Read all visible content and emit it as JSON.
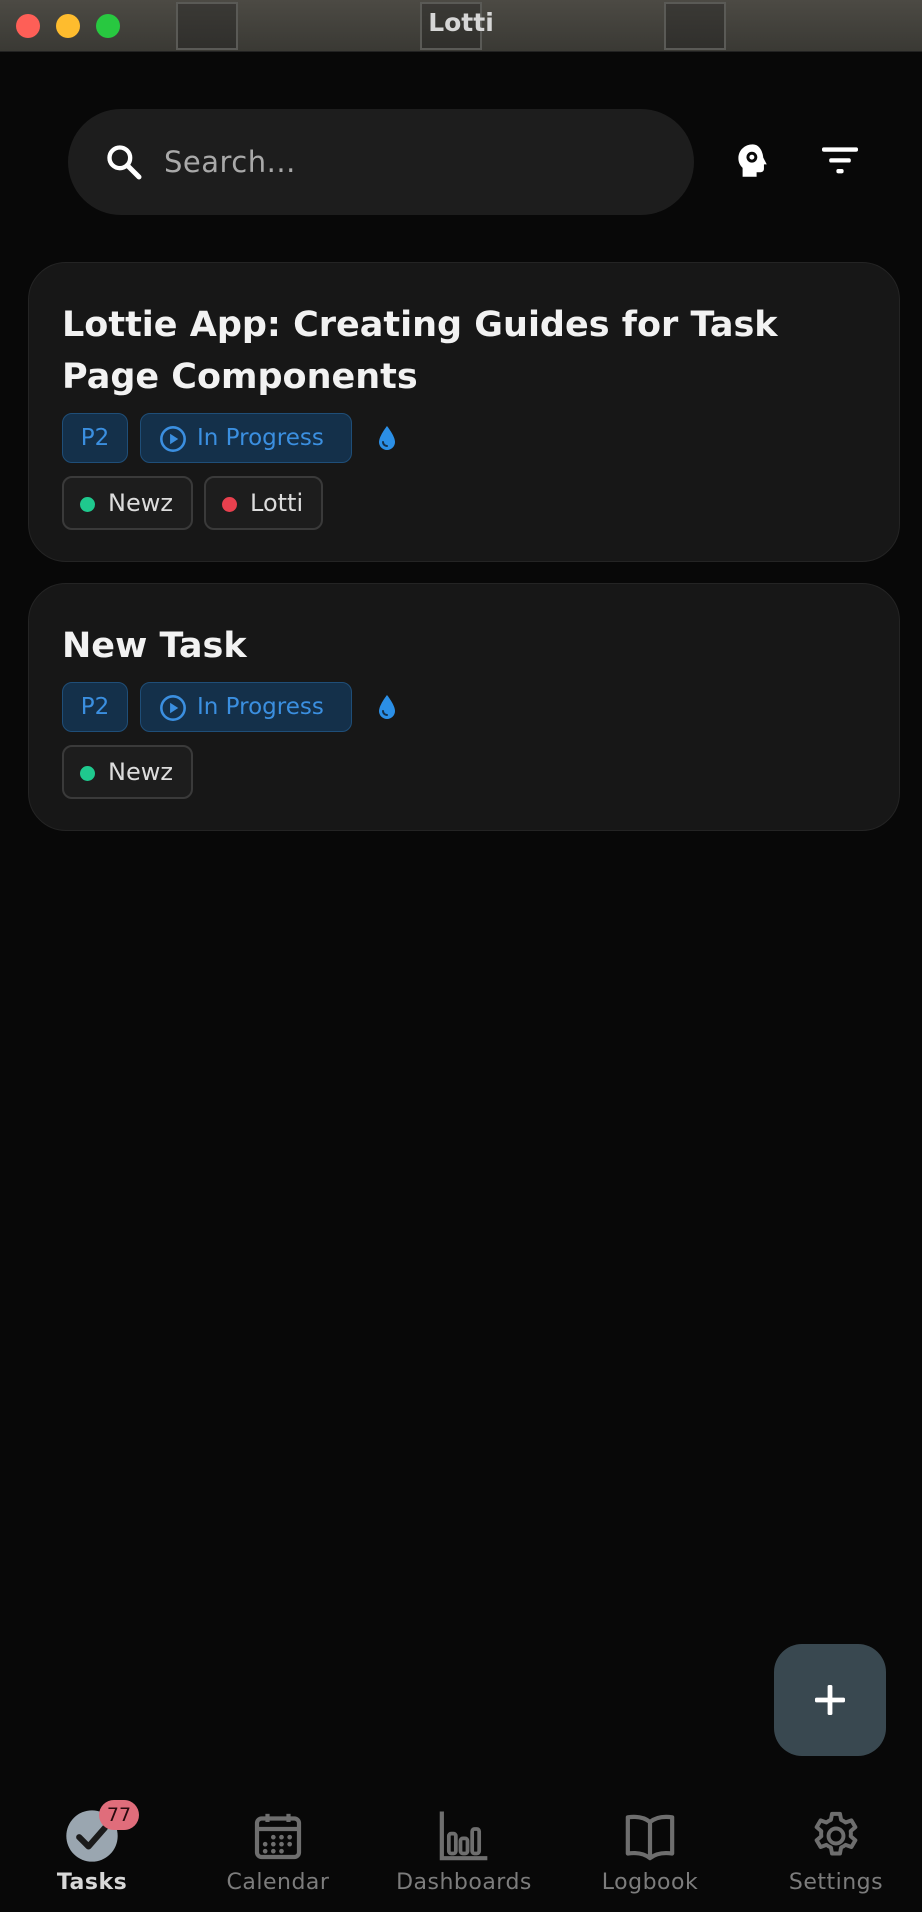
{
  "window": {
    "title": "Lotti"
  },
  "search": {
    "placeholder": "Search...",
    "icon": "search-icon"
  },
  "header_icons": {
    "head": "head-gear-icon",
    "filter": "filter-icon"
  },
  "tasks": [
    {
      "title": "Lottie App: Creating Guides for Task Page Components",
      "priority": "P2",
      "status": "In Progress",
      "tags": [
        {
          "label": "Newz",
          "color": "#1fc98e"
        },
        {
          "label": "Lotti",
          "color": "#e8404e"
        }
      ]
    },
    {
      "title": "New Task",
      "priority": "P2",
      "status": "In Progress",
      "tags": [
        {
          "label": "Newz",
          "color": "#1fc98e"
        }
      ]
    }
  ],
  "colors": {
    "accent": "#3b8fe0",
    "fab": "#394850",
    "badge": "#e06d7b"
  },
  "nav": {
    "items": [
      {
        "label": "Tasks",
        "icon": "tasks-check-icon",
        "badge": "77",
        "active": true
      },
      {
        "label": "Calendar",
        "icon": "calendar-icon"
      },
      {
        "label": "Dashboards",
        "icon": "bar-chart-icon"
      },
      {
        "label": "Logbook",
        "icon": "book-icon"
      },
      {
        "label": "Settings",
        "icon": "gear-icon"
      }
    ]
  }
}
